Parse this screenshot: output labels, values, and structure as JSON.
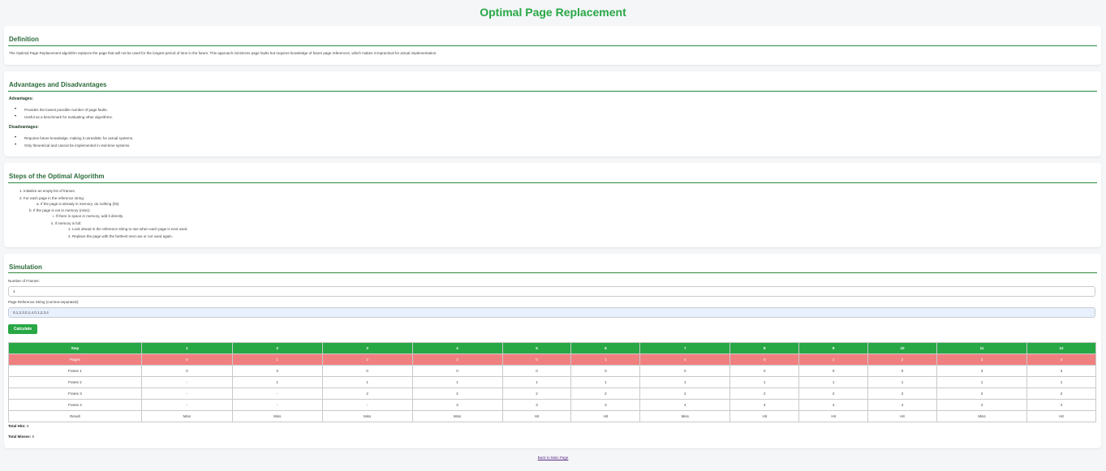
{
  "title": "Optimal Page Replacement",
  "definition": {
    "heading": "Definition",
    "text": "The Optimal Page Replacement algorithm replaces the page that will not be used for the longest period of time in the future. This approach minimizes page faults but requires knowledge of future page references, which makes it impractical for actual implementation."
  },
  "adv": {
    "heading": "Advantages and Disadvantages",
    "adv_title": "Advantages:",
    "adv_items": [
      "Provides the lowest possible number of page faults.",
      "Useful as a benchmark for evaluating other algorithms."
    ],
    "dis_title": "Disadvantages:",
    "dis_items": [
      "Requires future knowledge, making it unrealistic for actual systems.",
      "Only theoretical and cannot be implemented in real-time systems."
    ]
  },
  "steps": {
    "heading": "Steps of the Optimal Algorithm",
    "s1": "1. Initialize an empty list of frames.",
    "s2": "2. For each page in the reference string:",
    "s2a": "a. If the page is already in memory, do nothing (hit).",
    "s2b": "b. If the page is not in memory (miss):",
    "s2b1": "i. If there is space in memory, add it directly.",
    "s2b2": "ii. If memory is full:",
    "s2b2a": "1. Look ahead in the reference string to see when each page is next used.",
    "s2b2b": "2. Replace the page with the farthest next use or not used again."
  },
  "sim": {
    "heading": "Simulation",
    "frames_label": "Number of Frames:",
    "frames_value": "4",
    "ref_label": "Page Reference String (comma-separated):",
    "ref_value": "0,1,2,3,0,1,4,0,1,2,3,4",
    "calc_label": "Calculate",
    "table": {
      "header_label": "Step",
      "steps": [
        "1",
        "2",
        "3",
        "4",
        "5",
        "6",
        "7",
        "8",
        "9",
        "10",
        "11",
        "12"
      ],
      "pages_label": "Pages",
      "pages": [
        "0",
        "1",
        "2",
        "3",
        "0",
        "1",
        "4",
        "0",
        "1",
        "2",
        "3",
        "4"
      ],
      "frames": [
        {
          "label": "Frame 1",
          "values": [
            "0",
            "0",
            "0",
            "0",
            "0",
            "0",
            "0",
            "0",
            "0",
            "0",
            "3",
            "3"
          ]
        },
        {
          "label": "Frame 2",
          "values": [
            "-",
            "1",
            "1",
            "1",
            "1",
            "1",
            "1",
            "1",
            "1",
            "1",
            "1",
            "1"
          ]
        },
        {
          "label": "Frame 3",
          "values": [
            "-",
            "-",
            "2",
            "2",
            "2",
            "2",
            "2",
            "2",
            "2",
            "2",
            "2",
            "2"
          ]
        },
        {
          "label": "Frame 4",
          "values": [
            "-",
            "-",
            "-",
            "3",
            "3",
            "3",
            "4",
            "4",
            "4",
            "4",
            "4",
            "4"
          ]
        }
      ],
      "result_label": "Result",
      "results": [
        "Miss",
        "Miss",
        "Miss",
        "Miss",
        "Hit",
        "Hit",
        "Miss",
        "Hit",
        "Hit",
        "Hit",
        "Miss",
        "Hit"
      ]
    },
    "hits_label": "Total Hits:",
    "hits_value": "6",
    "misses_label": "Total Misses:",
    "misses_value": "6"
  },
  "back_link": "Back to Main Page",
  "colors": {
    "accent": "#28a745",
    "pages_row": "#f08080",
    "heading": "#2c6b3a"
  }
}
